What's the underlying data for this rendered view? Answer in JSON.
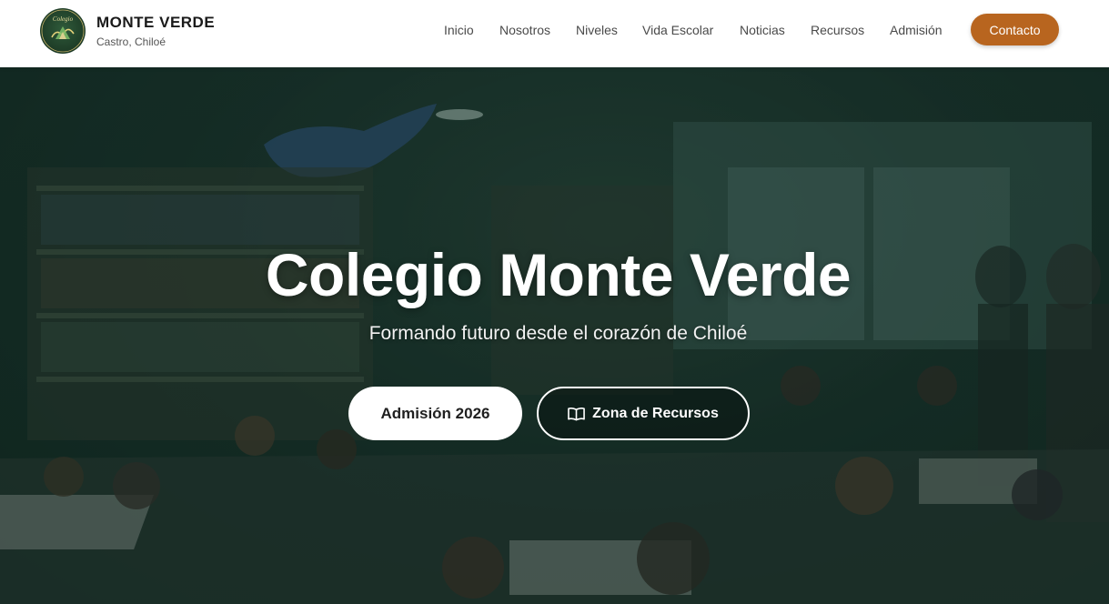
{
  "brand": {
    "name": "MONTE VERDE",
    "location": "Castro, Chiloé",
    "logo_text": "Colegio"
  },
  "nav": {
    "items": [
      "Inicio",
      "Nosotros",
      "Niveles",
      "Vida Escolar",
      "Noticias",
      "Recursos",
      "Admisión"
    ],
    "cta_label": "Contacto"
  },
  "hero": {
    "title": "Colegio Monte Verde",
    "subtitle": "Formando futuro desde el corazón de Chiloé",
    "primary_button": "Admisión 2026",
    "secondary_button": "Zona de Recursos",
    "secondary_icon": "book-open-icon"
  },
  "colors": {
    "accent": "#b8651f",
    "logo_green": "#1d3b26",
    "hero_overlay": "#17302a"
  }
}
